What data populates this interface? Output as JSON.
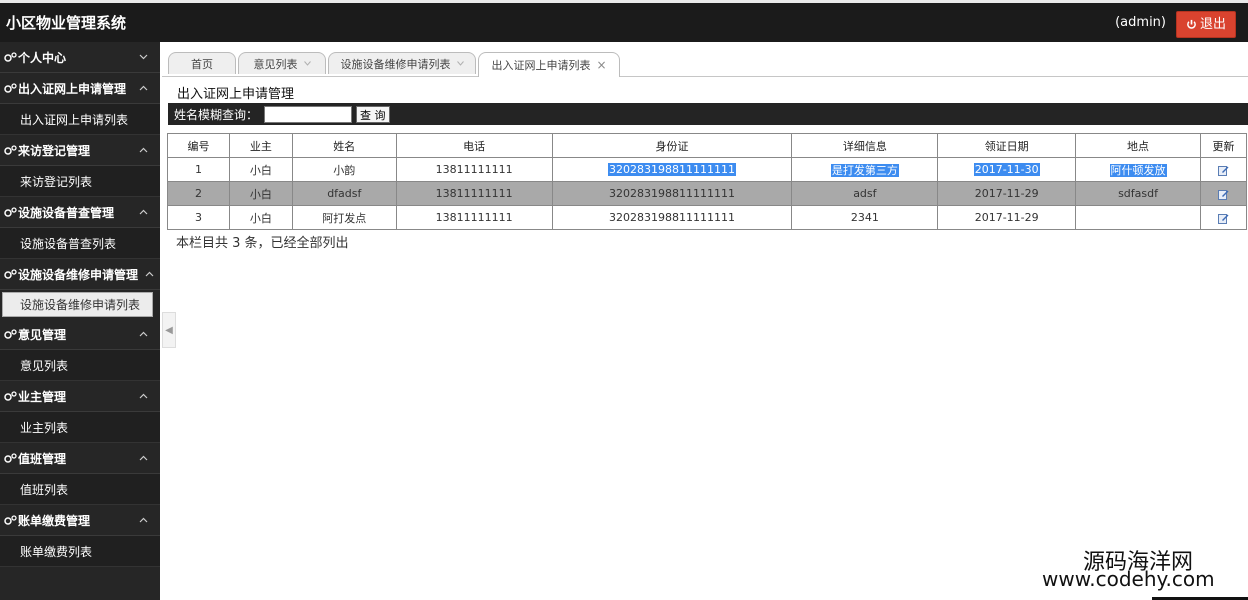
{
  "header": {
    "title": "小区物业管理系统",
    "user": "(admin)",
    "logout_label": "退出"
  },
  "sidebar": {
    "groups": [
      {
        "label": "个人中心",
        "items": []
      },
      {
        "label": "出入证网上申请管理",
        "items": [
          "出入证网上申请列表"
        ]
      },
      {
        "label": "来访登记管理",
        "items": [
          "来访登记列表"
        ]
      },
      {
        "label": "设施设备普查管理",
        "items": [
          "设施设备普查列表"
        ]
      },
      {
        "label": "设施设备维修申请管理",
        "items": [
          "设施设备维修申请列表"
        ]
      },
      {
        "label": "意见管理",
        "items": [
          "意见列表"
        ]
      },
      {
        "label": "业主管理",
        "items": [
          "业主列表"
        ]
      },
      {
        "label": "值班管理",
        "items": [
          "值班列表"
        ]
      },
      {
        "label": "账单缴费管理",
        "items": [
          "账单缴费列表"
        ]
      }
    ],
    "active_item": "设施设备维修申请列表"
  },
  "tabs": [
    {
      "label": "首页"
    },
    {
      "label": "意见列表"
    },
    {
      "label": "设施设备维修申请列表"
    },
    {
      "label": "出入证网上申请列表",
      "active": true
    }
  ],
  "page": {
    "section_title": "出入证网上申请管理",
    "search_label": "姓名模糊查询：",
    "search_value": "",
    "search_button": "查 询",
    "footer": "本栏目共 3 条，已经全部列出"
  },
  "table": {
    "columns": [
      "编号",
      "业主",
      "姓名",
      "电话",
      "身份证",
      "详细信息",
      "领证日期",
      "地点",
      "更新"
    ],
    "rows": [
      [
        "1",
        "小白",
        "小韵",
        "13811111111",
        "320283198811111111",
        "是打发第三方",
        "2017-11-30",
        "阿什顿发放"
      ],
      [
        "2",
        "小白",
        "dfadsf",
        "13811111111",
        "320283198811111111",
        "adsf",
        "2017-11-29",
        "sdfasdf"
      ],
      [
        "3",
        "小白",
        "阿打发点",
        "13811111111",
        "320283198811111111",
        "2341",
        "2017-11-29",
        ""
      ]
    ]
  },
  "watermark": {
    "line1": "源码海洋网",
    "line2": "www.codehy.com"
  },
  "icons": {
    "group": "gears-icon",
    "chevron": "chevron-up-icon",
    "edit": "edit-icon",
    "logout": "power-icon"
  },
  "colors": {
    "topbar": "#1b1b1b",
    "sidebar": "#262626",
    "logout": "#d9432f",
    "selection": "#3d8cf0",
    "alt_row": "#a9a9a9"
  }
}
